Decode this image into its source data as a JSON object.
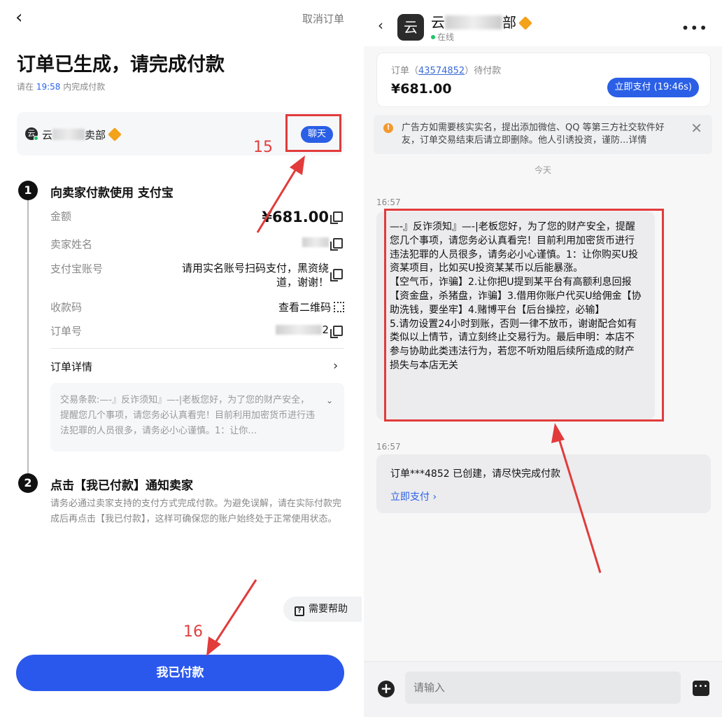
{
  "left": {
    "cancel_label": "取消订单",
    "title": "订单已生成，请完成付款",
    "timer_prefix": "请在",
    "timer_value": "19:58",
    "timer_suffix": "内完成付款",
    "seller": {
      "logo_char": "云",
      "name_prefix": "云",
      "name_suffix": "卖部",
      "chat_label": "聊天"
    },
    "step1": {
      "num": "1",
      "title": "向卖家付款使用 支付宝",
      "rows": [
        {
          "label": "金额",
          "value": "¥681.00"
        },
        {
          "label": "卖家姓名",
          "value": ""
        },
        {
          "label": "支付宝账号",
          "value": "请用实名账号扫码支付，黑资绕道，谢谢！"
        },
        {
          "label": "收款码",
          "value": "查看二维码"
        },
        {
          "label": "订单号",
          "value": "2"
        }
      ],
      "detail_label": "订单详情",
      "terms_text": "交易条款:—-』反诈须知』—-|老板您好，为了您的财产安全，提醒您几个事项，请您务必认真看完！目前利用加密货币进行违法犯罪的人员很多，请务必小心谨慎。1：让你…"
    },
    "step2": {
      "num": "2",
      "title": "点击【我已付款】通知卖家",
      "desc": "请务必通过卖家支持的支付方式完成付款。为避免误解，请在实际付款完成后再点击【我已付款】，这样可确保您的账户始终处于正常使用状态。"
    },
    "help_label": "需要帮助",
    "paid_label": "我已付款",
    "annotations": {
      "n15": "15",
      "n16": "16"
    }
  },
  "right": {
    "avatar_char": "云",
    "name_prefix": "云",
    "name_suffix": "部",
    "status": "在线",
    "order": {
      "prefix": "订单（",
      "id": "43574852",
      "suffix": "）待付款",
      "price": "¥681.00",
      "pay_label": "立即支付 (19:46s)"
    },
    "notice": "广告方如需要核实实名，提出添加微信、QQ 等第三方社交软件好友，订单交易结束后请立即删除。他人引诱投资，谨防...详情",
    "today": "今天",
    "time1": "16:57",
    "message": "—-』反诈须知』—-|老板您好，为了您的财产安全，提醒您几个事项，请您务必认真看完！目前利用加密货币进行违法犯罪的人员很多，请务必小心谨慎。1：让你购买U投资某项目，比如买U投资某某币以后能暴涨。\n【空气币，诈骗】2.让你把U提到某平台有高额利息回报【资金盘，杀猪盘，诈骗】3.借用你账户代买U给佣金【协助洗钱，要坐牢】4.赌博平台【后台操控，必输】\n5.请勿设置24小时到账，否则一律不放币，谢谢配合如有类似以上情节，请立刻终止交易行为。最后申明：本店不参与协助此类违法行为，若您不听劝阻后续所造成的财产损失与本店无关",
    "time2": "16:57",
    "msg2_text": "订单***4852 已创建，请尽快完成付款",
    "msg2_link": "立即支付 ›",
    "input_placeholder": "请输入"
  },
  "colors": {
    "primary": "#2b58ec",
    "annotation": "#e23b3b",
    "online": "#1ec36b",
    "warn": "#f29a2e"
  }
}
